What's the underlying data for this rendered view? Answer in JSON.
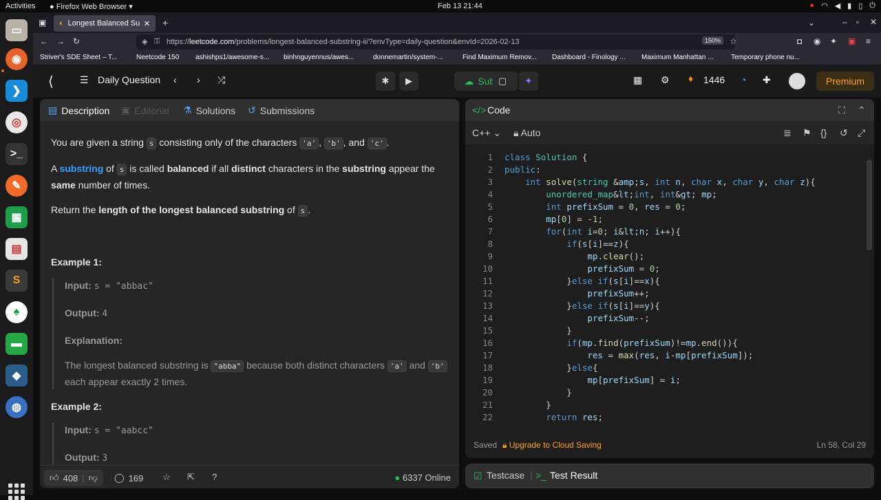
{
  "system": {
    "activities": "Activities",
    "app_name": "Firefox Web Browser",
    "clock": "Feb 13  21:44"
  },
  "browser": {
    "tab_title": "Longest Balanced Substri",
    "url_prefix": "https://",
    "url_domain": "leetcode.com",
    "url_path": "/problems/longest-balanced-substring-ii/?envType=daily-question&envId=2026-02-13",
    "zoom": "150%",
    "bookmarks": [
      "Striver's SDE Sheet – T...",
      "Neetcode 150",
      "ashishps1/awesome-s...",
      "binhnguyennus/awes...",
      "donnemartin/system-...",
      "Find Maximum Remov...",
      "Dashboard - Finology ...",
      "Maximum Manhattan ...",
      "Temporary phone nu..."
    ]
  },
  "header": {
    "title": "Daily Question",
    "submit": "Submit",
    "streak": "1446",
    "premium": "Premium"
  },
  "left_tabs": {
    "description": "Description",
    "editorial": "Editorial",
    "solutions": "Solutions",
    "submissions": "Submissions"
  },
  "problem": {
    "p1_a": "You are given a string ",
    "p1_s": "s",
    "p1_b": " consisting only of the characters ",
    "p1_a_char": "'a'",
    "p1_b_char": "'b'",
    "p1_and": ", and ",
    "p1_c_char": "'c'",
    "p2_a": "A ",
    "p2_substring": "substring",
    "p2_of": " of ",
    "p2_s": "s",
    "p2_is": " is called ",
    "p2_balanced": "balanced",
    "p2_ifall": " if all ",
    "p2_distinct": "distinct",
    "p2_chars": " characters in the ",
    "p2_substring2": "substring",
    "p2_appear": " appear the",
    "p2_same": "same",
    "p2_num": " number of times.",
    "p3_a": "Return the ",
    "p3_bold": "length of the longest balanced substring",
    "p3_of": " of ",
    "p3_s": "s",
    "p3_end": ".",
    "ex1_title": "Example 1:",
    "ex1_input_label": "Input:",
    "ex1_input": "s = \"abbac\"",
    "ex1_output_label": "Output:",
    "ex1_output": "4",
    "ex1_expl_label": "Explanation:",
    "ex1_expl_a": "The longest balanced substring is ",
    "ex1_expl_code": "\"abba\"",
    "ex1_expl_b": " because both distinct characters ",
    "ex1_expl_ca": "'a'",
    "ex1_expl_and": " and ",
    "ex1_expl_cb": "'b'",
    "ex1_expl_c": "each appear exactly 2 times.",
    "ex2_title": "Example 2:",
    "ex2_input_label": "Input:",
    "ex2_input": "s = \"aabcc\"",
    "ex2_output_label": "Output:",
    "ex2_output": "3"
  },
  "footer": {
    "likes": "408",
    "comments": "169",
    "online": "6337 Online"
  },
  "code_panel": {
    "title": "Code",
    "language": "C++",
    "mode": "Auto",
    "saved": "Saved",
    "upgrade": "Upgrade to Cloud Saving",
    "position": "Ln 58, Col 29"
  },
  "code_lines": [
    "class Solution {",
    "public:",
    "    int solve(string &s, int n, char x, char y, char z){",
    "        unordered_map<int, int> mp;",
    "        int prefixSum = 0, res = 0;",
    "        mp[0] = -1;",
    "        for(int i=0; i<n; i++){",
    "            if(s[i]==z){",
    "                mp.clear();",
    "                prefixSum = 0;",
    "            }else if(s[i]==x){",
    "                prefixSum++;",
    "            }else if(s[i]==y){",
    "                prefixSum--;",
    "            }",
    "            if(mp.find(prefixSum)!=mp.end()){",
    "                res = max(res, i-mp[prefixSum]);",
    "            }else{",
    "                mp[prefixSum] = i;",
    "            }",
    "        }",
    "        return res;"
  ],
  "test_panel": {
    "testcase": "Testcase",
    "test_result": "Test Result"
  }
}
